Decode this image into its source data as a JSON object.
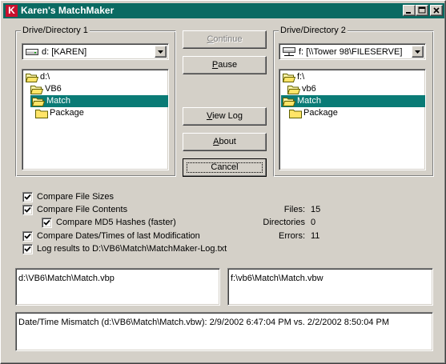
{
  "window": {
    "title": "Karen's MatchMaker",
    "app_icon_letter": "K"
  },
  "group1": {
    "label": "Drive/Directory 1",
    "drive": "d: [KAREN]",
    "folders": [
      "d:\\",
      "VB6",
      "Match",
      "Package"
    ],
    "selected_index": 2
  },
  "group2": {
    "label": "Drive/Directory 2",
    "drive": "f: [\\\\Tower 98\\FILESERVE]",
    "folders": [
      "f:\\",
      "vb6",
      "Match",
      "Package"
    ],
    "selected_index": 2
  },
  "buttons": {
    "continue": {
      "pre": "",
      "accel": "C",
      "post": "ontinue",
      "enabled": false
    },
    "pause": {
      "pre": "",
      "accel": "P",
      "post": "ause",
      "enabled": true
    },
    "view_log": {
      "pre": "",
      "accel": "V",
      "post": "iew Log",
      "enabled": true
    },
    "about": {
      "pre": "",
      "accel": "A",
      "post": "bout",
      "enabled": true
    },
    "cancel": {
      "label": "Cancel",
      "enabled": true,
      "default": true
    }
  },
  "options": {
    "compare_sizes": {
      "label": "Compare File Sizes",
      "checked": true
    },
    "compare_contents": {
      "label": "Compare File Contents",
      "checked": true
    },
    "compare_md5": {
      "label": "Compare MD5 Hashes (faster)",
      "checked": true
    },
    "compare_dates": {
      "label": "Compare Dates/Times of last Modification",
      "checked": true
    },
    "log_results": {
      "label": "Log results to D:\\VB6\\Match\\MatchMaker-Log.txt",
      "checked": true
    }
  },
  "stats": {
    "files_label": "Files:",
    "files_value": "15",
    "dirs_label": "Directories",
    "dirs_value": "0",
    "errors_label": "Errors:",
    "errors_value": "11"
  },
  "current_file_1": "d:\\VB6\\Match\\Match.vbp",
  "current_file_2": "f:\\vb6\\Match\\Match.vbw",
  "status_message": "Date/Time Mismatch (d:\\VB6\\Match\\Match.vbw): 2/9/2002 6:47:04 PM vs. 2/2/2002 8:50:04 PM",
  "colors": {
    "title_bar": "#0a6a62",
    "selection": "#0a7b76",
    "face": "#d4d0c8"
  },
  "icons": {
    "drive1": "hard-drive-icon",
    "drive2": "network-drive-icon",
    "folder_open": "open-folder-icon",
    "folder_closed": "closed-folder-icon"
  }
}
